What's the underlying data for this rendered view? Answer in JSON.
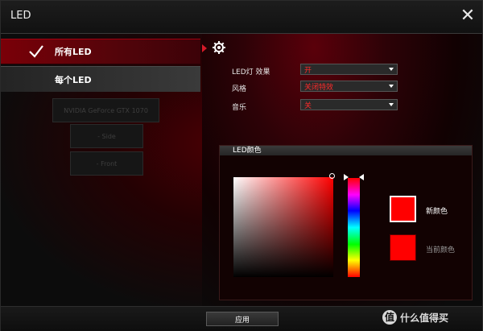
{
  "window": {
    "title": "LED",
    "close_label": "✕"
  },
  "left_nav": {
    "items": [
      {
        "label": "所有LED",
        "active": true
      },
      {
        "label": "每个LED",
        "active": false
      }
    ],
    "devices": [
      {
        "label": "NVIDIA GeForce GTX 1070"
      },
      {
        "label": "- Side"
      },
      {
        "label": "- Front"
      }
    ]
  },
  "settings": {
    "icon": "gear-icon",
    "rows": [
      {
        "label": "LED灯 效果",
        "value": "开"
      },
      {
        "label": "风格",
        "value": "关闭特效"
      },
      {
        "label": "音乐",
        "value": "关"
      }
    ]
  },
  "color_picker": {
    "title": "LED颜色",
    "new_color_label": "新颜色",
    "current_color_label": "当前颜色",
    "new_color": "#ff0000",
    "current_color": "#ff0000"
  },
  "footer": {
    "apply_label": "应用",
    "watermark_icon": "值",
    "watermark_text": "什么值得买"
  },
  "colors": {
    "accent": "#d61a28",
    "dropdown_text": "#ff2a2a"
  }
}
